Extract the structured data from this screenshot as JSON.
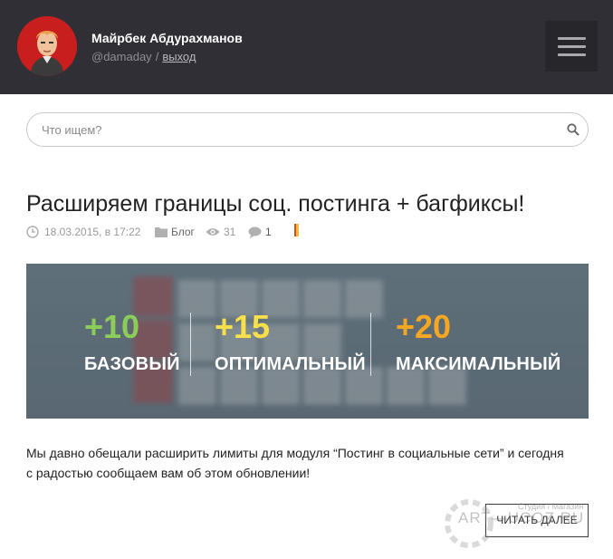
{
  "header": {
    "user_name": "Майрбек Абдурахманов",
    "handle": "@damaday",
    "separator": "/",
    "logout_label": "выход"
  },
  "search": {
    "placeholder": "Что ищем?",
    "value": ""
  },
  "post": {
    "title": "Расширяем границы соц. постинга + багфиксы!",
    "date": "18.03.2015, в 17:22",
    "category": "Блог",
    "views": "31",
    "comments": "1",
    "excerpt": "Мы давно обещали расширить лимиты для модуля “Постинг в социальные сети” и сегодня с радостью сообщаем вам об этом обновлении!",
    "read_more": "ЧИТАТЬ ДАЛЕЕ"
  },
  "banner": {
    "tiers": [
      {
        "value": "+10",
        "label": "БАЗОВЫЙ",
        "color": "#8ccd5a"
      },
      {
        "value": "+15",
        "label": "ОПТИМАЛЬНЫЙ",
        "color": "#f7e04a"
      },
      {
        "value": "+20",
        "label": "МАКСИМАЛЬНЫЙ",
        "color": "#f5a623"
      }
    ]
  },
  "watermark": {
    "text": "ART—UCOZ.RU",
    "subtext": "Студия / Магазин"
  },
  "colors": {
    "header_bg": "#2f2f35",
    "accent_red": "#c81e1e"
  }
}
